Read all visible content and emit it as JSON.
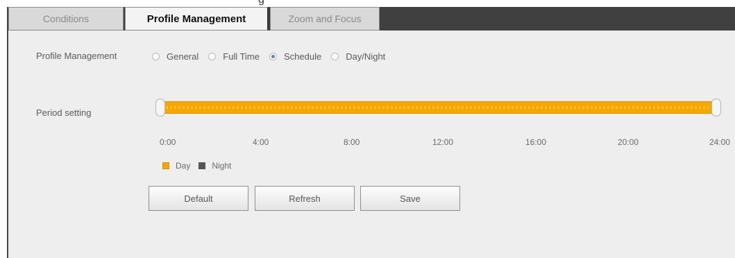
{
  "header_fragment": "g",
  "tabs": [
    {
      "label": "Conditions",
      "active": false
    },
    {
      "label": "Profile Management",
      "active": true
    },
    {
      "label": "Zoom and Focus",
      "active": false
    }
  ],
  "profile_management": {
    "label": "Profile Management",
    "options": [
      {
        "label": "General",
        "checked": false
      },
      {
        "label": "Full Time",
        "checked": false
      },
      {
        "label": "Schedule",
        "checked": true
      },
      {
        "label": "Day/Night",
        "checked": false
      }
    ]
  },
  "period_setting": {
    "label": "Period setting",
    "day_fraction": 1.0,
    "ticks": [
      "0:00",
      "4:00",
      "8:00",
      "12:00",
      "16:00",
      "20:00",
      "24:00"
    ]
  },
  "legend": {
    "day": "Day",
    "night": "Night"
  },
  "buttons": {
    "default": "Default",
    "refresh": "Refresh",
    "save": "Save"
  },
  "colors": {
    "day": "#f6a800",
    "night": "#555555",
    "tabbar": "#404040",
    "panel": "#eeeeee"
  }
}
